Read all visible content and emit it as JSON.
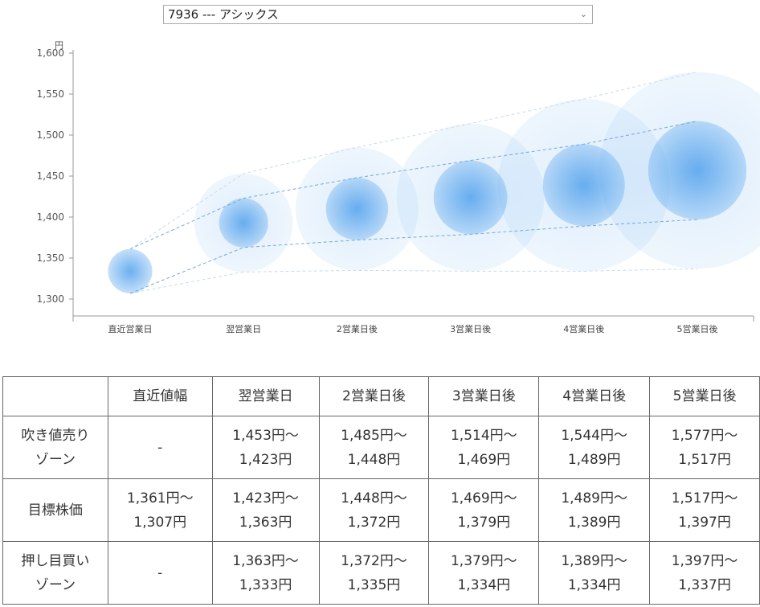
{
  "selector": {
    "value": "7936 --- アシックス"
  },
  "chart_data": {
    "type": "bubble",
    "yunit": "円",
    "ylim": [
      1280,
      1600
    ],
    "yticks": [
      "1,300",
      "1,350",
      "1,400",
      "1,450",
      "1,500",
      "1,550",
      "1,600"
    ],
    "categories": [
      "直近営業日",
      "翌営業日",
      "2営業日後",
      "3営業日後",
      "4営業日後",
      "5営業日後"
    ],
    "target_upper": [
      1361,
      1423,
      1448,
      1469,
      1489,
      1517
    ],
    "target_lower": [
      1307,
      1363,
      1372,
      1379,
      1389,
      1397
    ],
    "sell_upper": [
      null,
      1453,
      1485,
      1514,
      1544,
      1577
    ],
    "buy_lower": [
      null,
      1333,
      1335,
      1334,
      1334,
      1337
    ],
    "color": "#5aa6ee"
  },
  "table": {
    "headers": [
      "",
      "直近値幅",
      "翌営業日",
      "2営業日後",
      "3営業日後",
      "4営業日後",
      "5営業日後"
    ],
    "rows": [
      {
        "label": [
          "吹き値売り",
          "ゾーン"
        ],
        "cells": [
          [
            "-",
            ""
          ],
          [
            "1,453円～",
            "1,423円"
          ],
          [
            "1,485円～",
            "1,448円"
          ],
          [
            "1,514円～",
            "1,469円"
          ],
          [
            "1,544円～",
            "1,489円"
          ],
          [
            "1,577円～",
            "1,517円"
          ]
        ]
      },
      {
        "label": [
          "目標株価",
          ""
        ],
        "cells": [
          [
            "1,361円～",
            "1,307円"
          ],
          [
            "1,423円～",
            "1,363円"
          ],
          [
            "1,448円～",
            "1,372円"
          ],
          [
            "1,469円～",
            "1,379円"
          ],
          [
            "1,489円～",
            "1,389円"
          ],
          [
            "1,517円～",
            "1,397円"
          ]
        ]
      },
      {
        "label": [
          "押し目買い",
          "ゾーン"
        ],
        "cells": [
          [
            "-",
            ""
          ],
          [
            "1,363円～",
            "1,333円"
          ],
          [
            "1,372円～",
            "1,335円"
          ],
          [
            "1,379円～",
            "1,334円"
          ],
          [
            "1,389円～",
            "1,334円"
          ],
          [
            "1,397円～",
            "1,337円"
          ]
        ]
      }
    ]
  }
}
